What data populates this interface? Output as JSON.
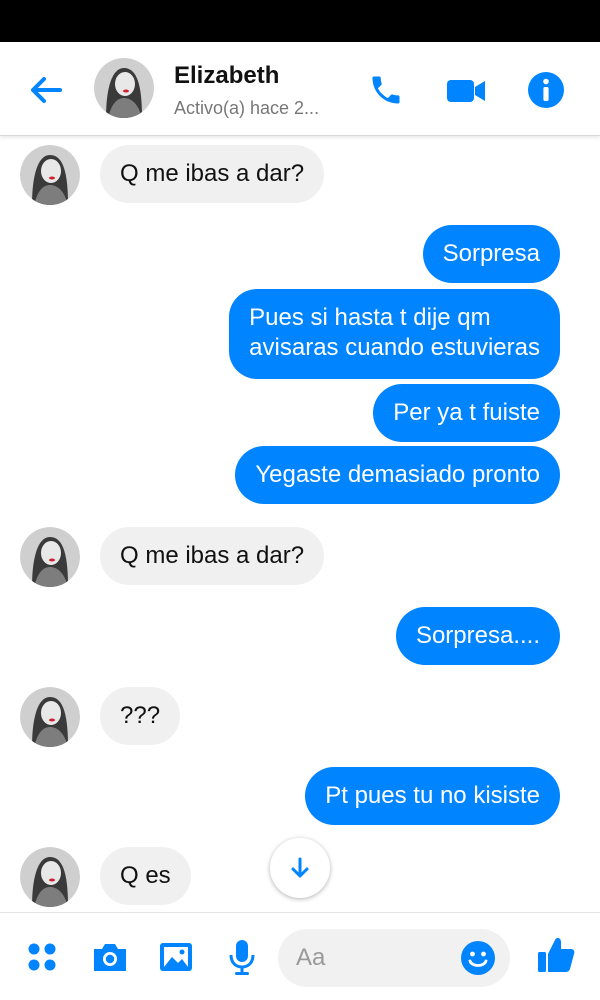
{
  "header": {
    "contact_name": "Elizabeth",
    "status": "Activo(a) hace 2...",
    "icons": [
      "back-arrow-icon",
      "phone-icon",
      "video-camera-icon",
      "info-icon"
    ]
  },
  "messages": [
    {
      "from": "contact",
      "text": "Q me ibas a dar?"
    },
    {
      "from": "me",
      "text": "Sorpresa"
    },
    {
      "from": "me",
      "text": "Pues si hasta t dije qm",
      "text2": "avisaras cuando estuvieras"
    },
    {
      "from": "me",
      "text": "Per ya t fuiste"
    },
    {
      "from": "me",
      "text": "Yegaste demasiado pronto"
    },
    {
      "from": "contact",
      "text": "Q me ibas a dar?"
    },
    {
      "from": "me",
      "text": "Sorpresa...."
    },
    {
      "from": "contact",
      "text": "???"
    },
    {
      "from": "me",
      "text": "Pt pues tu no kisiste"
    },
    {
      "from": "contact",
      "text": "Q es"
    }
  ],
  "composer": {
    "placeholder": "Aa",
    "icons": [
      "apps-icon",
      "camera-icon",
      "gallery-icon",
      "microphone-icon",
      "emoji-icon",
      "thumbs-up-icon"
    ]
  },
  "colors": {
    "accent": "#0084ff",
    "incoming_bubble": "#f0f0f0",
    "status_bar": "#000000"
  }
}
